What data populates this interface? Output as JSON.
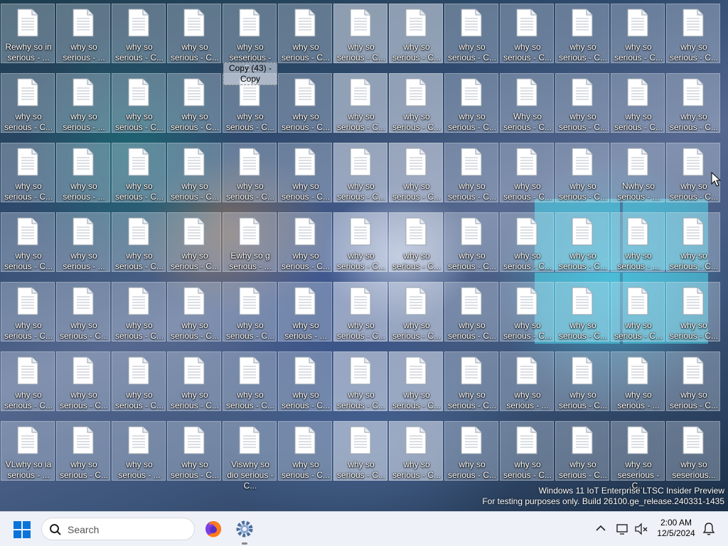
{
  "desktop": {
    "icons": [
      {
        "label": "Rewhy so in serious - ..."
      },
      {
        "label": "why so serious - ..."
      },
      {
        "label": "why so serious - C..."
      },
      {
        "label": "why so serious - C..."
      },
      {
        "label": "why so seserious - C..."
      },
      {
        "label": "why so serious - C..."
      },
      {
        "label": "why so serious - C..."
      },
      {
        "label": "why so serious - C..."
      },
      {
        "label": "why so serious - C..."
      },
      {
        "label": "why so serious - C..."
      },
      {
        "label": "why so serious - C..."
      },
      {
        "label": "why so serious - C..."
      },
      {
        "label": "why so serious - C..."
      },
      {
        "label": "why so serious - C..."
      },
      {
        "label": "why so serious - ..."
      },
      {
        "label": "why so serious - C..."
      },
      {
        "label": "why so serious - C..."
      },
      {
        "label": "why so serious - C..."
      },
      {
        "label": "why so serious - C..."
      },
      {
        "label": "why so serious - C..."
      },
      {
        "label": "why so serious - C..."
      },
      {
        "label": "why so serious - C..."
      },
      {
        "label": "Why so serious - C..."
      },
      {
        "label": "why so serious - C..."
      },
      {
        "label": "why so serious - C..."
      },
      {
        "label": "why so serious - C..."
      },
      {
        "label": "why so serious - C..."
      },
      {
        "label": "why so serious - ..."
      },
      {
        "label": "why so serious - C..."
      },
      {
        "label": "why so serious - C..."
      },
      {
        "label": "why so serious - C..."
      },
      {
        "label": "why so serious - C..."
      },
      {
        "label": "why so serious - C..."
      },
      {
        "label": "why so serious - C..."
      },
      {
        "label": "why so serious - C..."
      },
      {
        "label": "why so serious - C..."
      },
      {
        "label": "why so serious - C..."
      },
      {
        "label": "Nwhy so serious - ..."
      },
      {
        "label": "why so serious - C..."
      },
      {
        "label": "why so serious - C..."
      },
      {
        "label": "why so serious - ..."
      },
      {
        "label": "why so serious - C..."
      },
      {
        "label": "why so serious - C..."
      },
      {
        "label": "Ewhy so g serious - ..."
      },
      {
        "label": "why so serious - C..."
      },
      {
        "label": "why so serious - C..."
      },
      {
        "label": "why so serious - C..."
      },
      {
        "label": "why so serious - C..."
      },
      {
        "label": "why so serious - C..."
      },
      {
        "label": "why so serious - C..."
      },
      {
        "label": "why so serious - ..."
      },
      {
        "label": "why so serious - C..."
      },
      {
        "label": "why so serious - C..."
      },
      {
        "label": "why so serious - C..."
      },
      {
        "label": "why so serious - C..."
      },
      {
        "label": "why so serious - C..."
      },
      {
        "label": "why so serious - C..."
      },
      {
        "label": "why so serious - ..."
      },
      {
        "label": "why so serious - C..."
      },
      {
        "label": "why so serious - C..."
      },
      {
        "label": "why so serious - C..."
      },
      {
        "label": "why so serious - C..."
      },
      {
        "label": "why so serious - C..."
      },
      {
        "label": "why so serious - C..."
      },
      {
        "label": "why so serious - C..."
      },
      {
        "label": "why so serious - C..."
      },
      {
        "label": "why so serious - C..."
      },
      {
        "label": "why so serious - C..."
      },
      {
        "label": "why so serious - C..."
      },
      {
        "label": "why so serious - C..."
      },
      {
        "label": "why so serious - C..."
      },
      {
        "label": "why so serious - C..."
      },
      {
        "label": "why so serious - C..."
      },
      {
        "label": "why so serious - C..."
      },
      {
        "label": "why so serious - ..."
      },
      {
        "label": "why so serious - C..."
      },
      {
        "label": "why so serious - ..."
      },
      {
        "label": "why so serious - C..."
      },
      {
        "label": "VLwhy so ia serious - ..."
      },
      {
        "label": "why so serious - C..."
      },
      {
        "label": "why so serious - ..."
      },
      {
        "label": "why so serious - C..."
      },
      {
        "label": "Viswhy so dio serious - C..."
      },
      {
        "label": "why so serious - C..."
      },
      {
        "label": "why so serious - C..."
      },
      {
        "label": "why so serious - C..."
      },
      {
        "label": "why so serious - C..."
      },
      {
        "label": "why so serious - C..."
      },
      {
        "label": "why so serious - C..."
      },
      {
        "label": "why so seserious - C..."
      },
      {
        "label": "why so seserious..."
      }
    ],
    "rename_box": "Copy (43) -\nCopy",
    "watermark_line1": "Windows 11 IoT Enterprise LTSC Insider Preview",
    "watermark_line2": "For testing purposes only. Build 26100.ge_release.240331-1435"
  },
  "taskbar": {
    "search_label": "Search",
    "time": "2:00 AM",
    "date": "12/5/2024",
    "apps": [
      "firefox-icon",
      "settings-icon"
    ]
  }
}
